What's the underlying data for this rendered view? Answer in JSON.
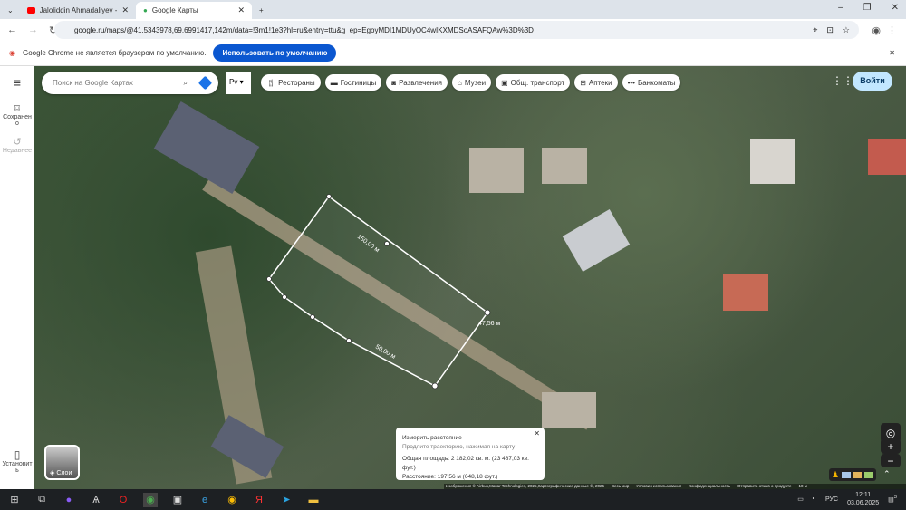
{
  "browser": {
    "tabs": [
      {
        "label": "Jaloliddin Ahmadaliyev - Bu ki...",
        "icon": "youtube-icon"
      },
      {
        "label": "Google Карты",
        "icon": "maps-pin-icon"
      }
    ],
    "url": "google.ru/maps/@41.5343978,69.6991417,142m/data=!3m1!1e3?hl=ru&entry=ttu&g_ep=EgoyMDI1MDUyOC4wIKXMDSoASAFQAw%3D%3D",
    "infobar_text": "Google Chrome не является браузером по умолчанию.",
    "infobar_button": "Использовать по умолчанию"
  },
  "sidebar": {
    "saved": "Сохранено",
    "recent": "Недавнее",
    "install": "Установить"
  },
  "search": {
    "placeholder": "Поиск на Google Картах",
    "lang": "Рv"
  },
  "chips": [
    "Рестораны",
    "Гостиницы",
    "Развлечения",
    "Музеи",
    "Общ. транспорт",
    "Аптеки",
    "Банкоматы"
  ],
  "signin": "Войти",
  "layers": "Слои",
  "measure": {
    "labels": [
      "150,00 м",
      "47,56 м",
      "50,00 м"
    ]
  },
  "popup": {
    "title": "Измерить расстояние",
    "hint": "Продлите траекторию, нажимая на карту",
    "area": "Общая площадь: 2 182,02 кв. м. (23 487,03 кв. фут.)",
    "distance": "Расстояние: 197,56 м (648,18 фут.)"
  },
  "footer": {
    "attribution": "Изображения © Airbus,Maxar Technologies, 2025,Картографические данные ©, 2025",
    "world": "Весь мир",
    "terms": "Условия использования",
    "privacy": "Конфиденциальность",
    "feedback": "Отправить отзыв о продукте",
    "scale": "10 м"
  },
  "taskbar": {
    "lang": "РУС",
    "time": "12:11",
    "date": "03.06.2025",
    "notifications": "3"
  }
}
